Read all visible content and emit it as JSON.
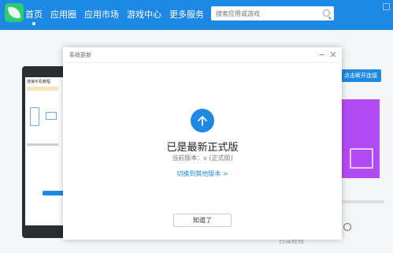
{
  "nav": {
    "items": [
      {
        "label": "首页",
        "active": true
      },
      {
        "label": "应用圈"
      },
      {
        "label": "应用市场"
      },
      {
        "label": "游戏中心"
      },
      {
        "label": "更多服务"
      }
    ]
  },
  "search": {
    "placeholder": "搜索应用或游戏"
  },
  "phone": {
    "title": "连接手机教程",
    "icon": "phone-icon"
  },
  "right": {
    "connect_label": "点击断开连接"
  },
  "dialog": {
    "title": "系统更新",
    "headline": "已是最新正式版",
    "version_text": "当前版本：v  (正式版)",
    "history_link": "切换到其他版本 >",
    "ok_label": "知道了"
  },
  "watermark": "百度经验",
  "colors": {
    "accent": "#1e88e5",
    "logo": "#2ecc71",
    "promo": "#b24bf3"
  }
}
